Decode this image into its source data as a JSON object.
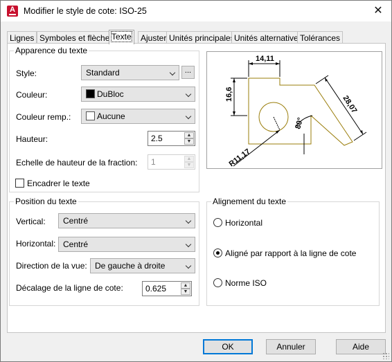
{
  "window": {
    "title": "Modifier le style de cote: ISO-25",
    "close_glyph": "✕",
    "app_icon_letter": "A"
  },
  "tabs": [
    {
      "label": "Lignes"
    },
    {
      "label": "Symboles et flèches"
    },
    {
      "label": "Texte"
    },
    {
      "label": "Ajuster"
    },
    {
      "label": "Unités principales"
    },
    {
      "label": "Unités alternatives"
    },
    {
      "label": "Tolérances"
    }
  ],
  "appearance": {
    "title": "Apparence du texte",
    "style_label": "Style:",
    "style_value": "Standard",
    "style_button": "...",
    "color_label": "Couleur:",
    "color_value": "DuBloc",
    "color_swatch": "#000000",
    "fill_label": "Couleur remp.:",
    "fill_value": "Aucune",
    "fill_swatch": "#ffffff",
    "height_label": "Hauteur:",
    "height_value": "2.5",
    "fraction_label": "Echelle de hauteur de la fraction:",
    "fraction_value": "1",
    "frame_label": "Encadrer le texte"
  },
  "position": {
    "title": "Position du texte",
    "vertical_label": "Vertical:",
    "vertical_value": "Centré",
    "horizontal_label": "Horizontal:",
    "horizontal_value": "Centré",
    "view_label": "Direction de la vue:",
    "view_value": "De gauche à droite",
    "offset_label": "Décalage de la ligne de cote:",
    "offset_value": "0.625"
  },
  "alignment": {
    "title": "Alignement du texte",
    "options": [
      {
        "label": "Horizontal",
        "checked": false
      },
      {
        "label": "Aligné par rapport à la ligne de cote",
        "checked": true
      },
      {
        "label": "Norme ISO",
        "checked": false
      }
    ]
  },
  "preview": {
    "dim_top": "14,11",
    "dim_left": "16,6",
    "dim_right": "28,07",
    "dim_angle": "80°",
    "dim_radius": "R11,17",
    "shape_color": "#9a7d0a"
  },
  "buttons": {
    "ok": "OK",
    "cancel": "Annuler",
    "help": "Aide"
  }
}
